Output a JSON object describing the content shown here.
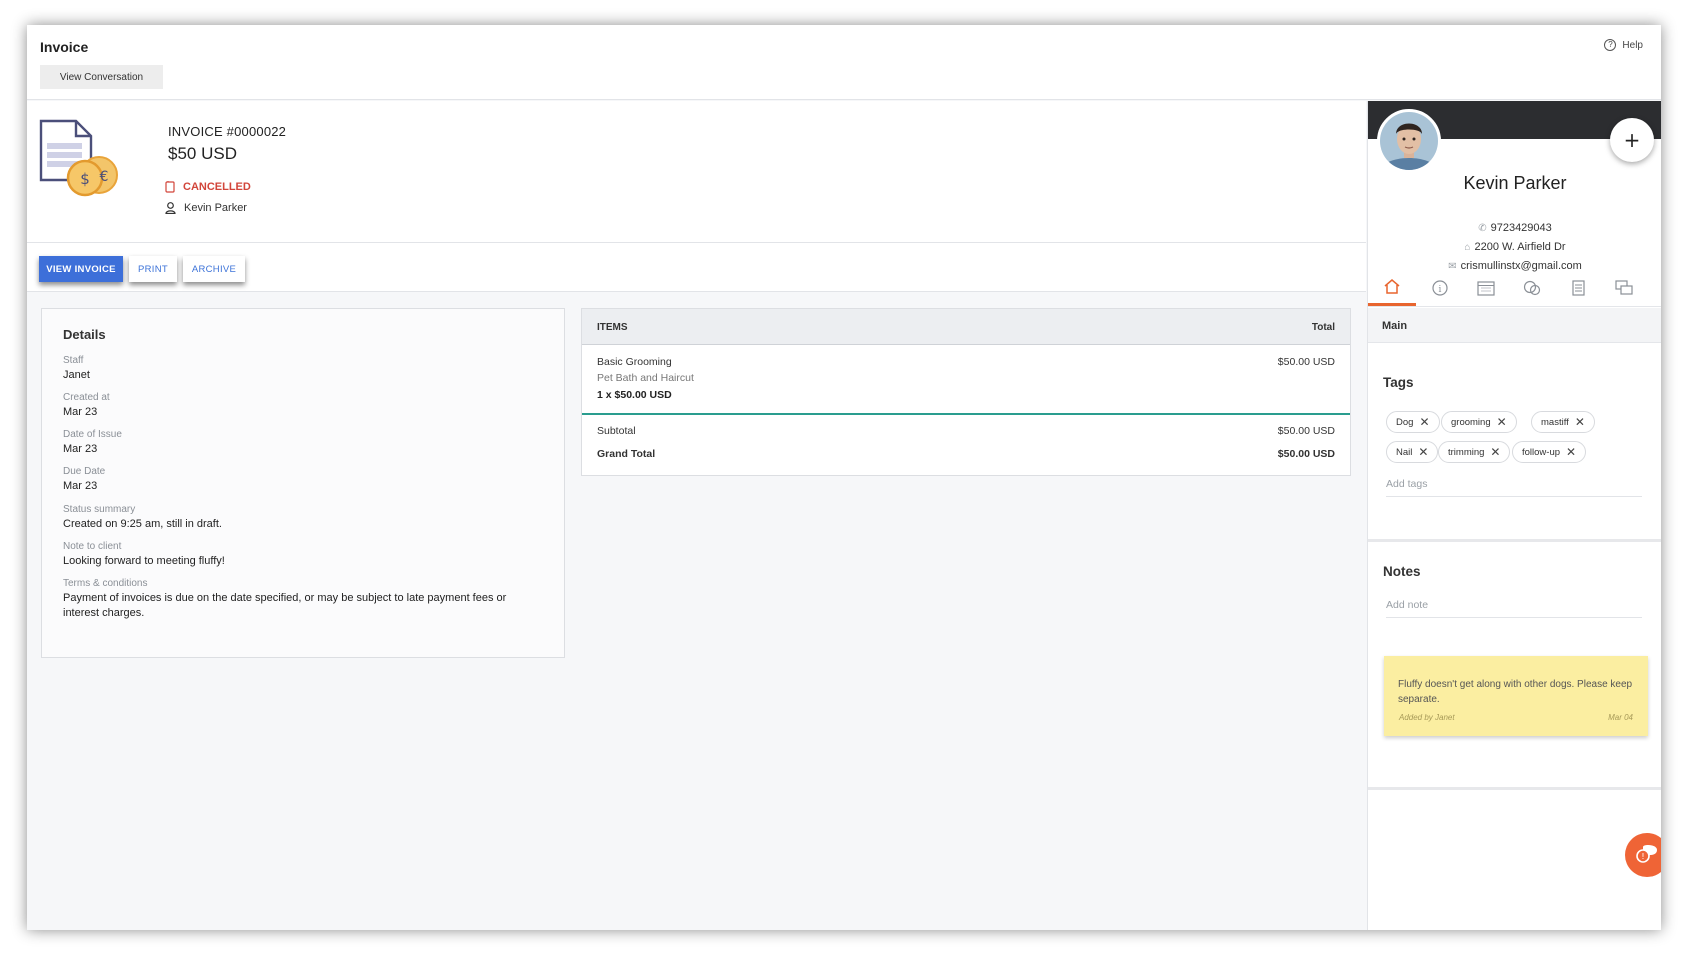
{
  "header": {
    "title": "Invoice",
    "view_conversation": "View Conversation",
    "help": "Help"
  },
  "invoice": {
    "number": "INVOICE #0000022",
    "amount": "$50 USD",
    "status": "CANCELLED",
    "client": "Kevin Parker"
  },
  "tabs": {
    "view_invoice": "VIEW INVOICE",
    "print": "PRINT",
    "archive": "ARCHIVE"
  },
  "details": {
    "title": "Details",
    "fields": [
      {
        "label": "Staff",
        "value": "Janet"
      },
      {
        "label": "Created at",
        "value": "Mar 23"
      },
      {
        "label": "Date of Issue",
        "value": "Mar 23"
      },
      {
        "label": "Due Date",
        "value": "Mar 23"
      },
      {
        "label": "Status summary",
        "value": "Created on 9:25 am, still in draft."
      },
      {
        "label": "Note to client",
        "value": "Looking forward to meeting fluffy!"
      },
      {
        "label": "Terms & conditions",
        "value": "Payment of invoices is due on the date specified, or may be subject to late payment fees or interest charges."
      }
    ]
  },
  "items": {
    "col_items": "ITEMS",
    "col_total": "Total",
    "rows": [
      {
        "name": "Basic Grooming",
        "desc": "Pet Bath and Haircut",
        "qty": "1 x $50.00 USD",
        "total": "$50.00 USD"
      }
    ],
    "subtotal_label": "Subtotal",
    "subtotal_value": "$50.00 USD",
    "grand_total_label": "Grand Total",
    "grand_total_value": "$50.00 USD"
  },
  "client": {
    "name": "Kevin Parker",
    "phone": "9723429043",
    "address": "2200 W. Airfield Dr",
    "email": "crismullinstx@gmail.com",
    "icon_tabs": [
      "home-icon",
      "info-icon",
      "calendar-icon",
      "pets-icon",
      "documents-icon",
      "messages-icon"
    ],
    "active_tab": "Main"
  },
  "tags": {
    "title": "Tags",
    "items": [
      "Dog",
      "grooming",
      "mastiff",
      "Nail",
      "trimming",
      "follow-up"
    ],
    "placeholder": "Add tags"
  },
  "notes": {
    "title": "Notes",
    "placeholder": "Add note",
    "card": {
      "text": "Fluffy doesn't get along with other dogs. Please keep separate.",
      "by": "Added by Janet",
      "date": "Mar 04"
    }
  },
  "colors": {
    "accent": "#3d6fd9",
    "danger": "#d2453a",
    "brand": "#ef6436",
    "note": "#fbeea1",
    "divider": "#2a9d8f"
  }
}
